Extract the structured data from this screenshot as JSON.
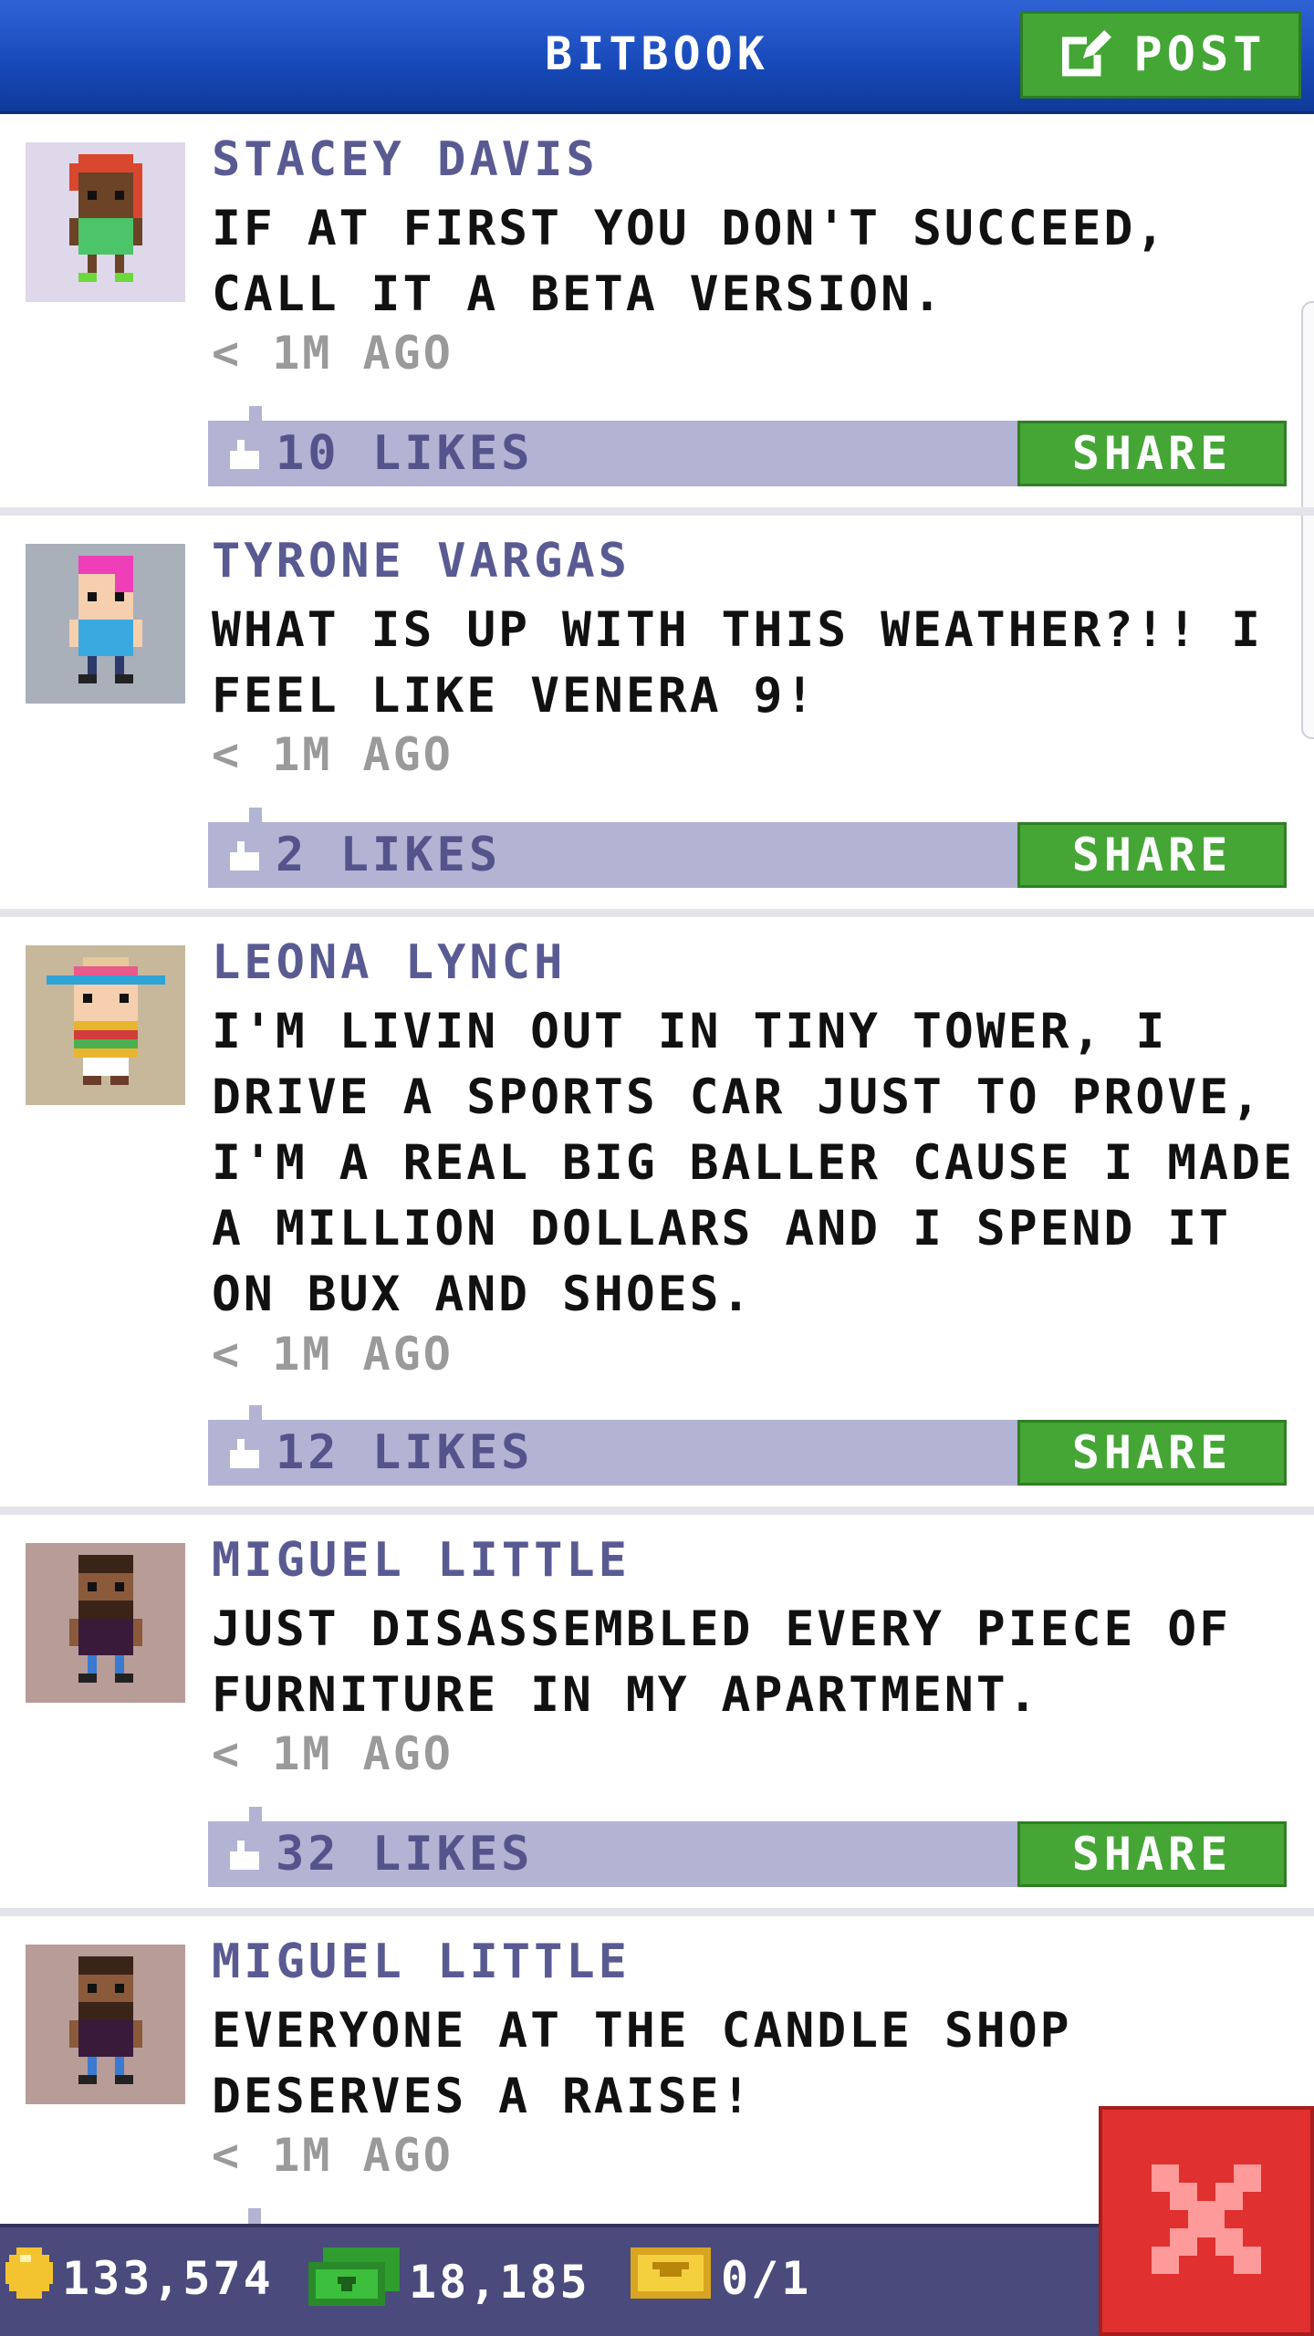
{
  "header": {
    "title": "BITBOOK",
    "post_label": "POST"
  },
  "posts": [
    {
      "author": "STACEY DAVIS",
      "message": "IF AT FIRST YOU DON'T SUCCEED, CALL IT A BETA VERSION.",
      "time": "< 1M AGO",
      "likes": "10 LIKES",
      "share_label": "SHARE",
      "avatar_icon": "redhead-character-avatar"
    },
    {
      "author": "TYRONE VARGAS",
      "message": "WHAT IS UP WITH THIS WEATHER?!! I FEEL LIKE VENERA 9!",
      "time": "< 1M AGO",
      "likes": "2 LIKES",
      "share_label": "SHARE",
      "avatar_icon": "pink-hair-character-avatar"
    },
    {
      "author": "LEONA LYNCH",
      "message": "I'M LIVIN OUT IN TINY TOWER, I DRIVE A SPORTS CAR JUST TO PROVE, I'M A REAL BIG BALLER CAUSE I MADE A MILLION DOLLARS AND I SPEND IT ON BUX AND SHOES.",
      "time": "< 1M AGO",
      "likes": "12 LIKES",
      "share_label": "SHARE",
      "avatar_icon": "sombrero-character-avatar"
    },
    {
      "author": "MIGUEL LITTLE",
      "message": "JUST DISASSEMBLED EVERY PIECE OF FURNITURE IN MY APARTMENT.",
      "time": "< 1M AGO",
      "likes": "32 LIKES",
      "share_label": "SHARE",
      "avatar_icon": "bearded-character-avatar"
    },
    {
      "author": "MIGUEL LITTLE",
      "message": "EVERYONE AT THE CANDLE SHOP DESERVES A RAISE!",
      "time": "< 1M AGO",
      "avatar_icon": "bearded-character-avatar"
    }
  ],
  "bottom_bar": {
    "coins": "133,574",
    "bux": "18,185",
    "tickets": "0/1"
  },
  "colors": {
    "header_blue": "#1748b8",
    "share_green": "#45a636",
    "likes_bar": "#b3b3d3",
    "close_red": "#e0302f"
  }
}
